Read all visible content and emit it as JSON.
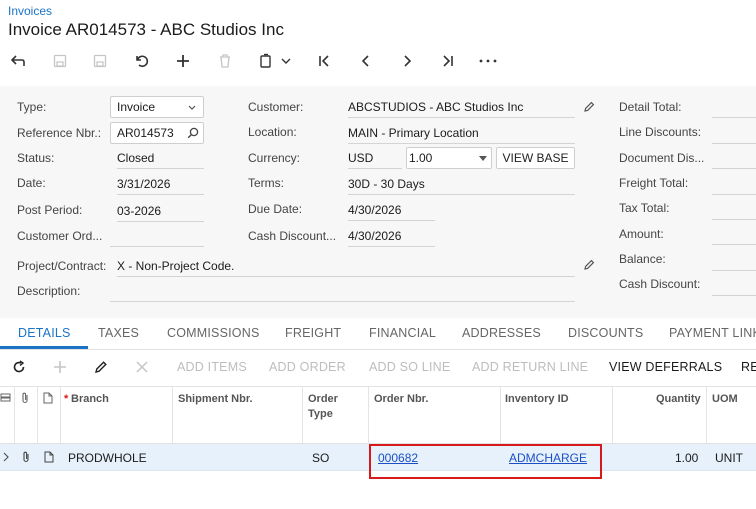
{
  "breadcrumb": "Invoices",
  "title": "Invoice AR014573 - ABC Studios Inc",
  "form": {
    "type_label": "Type:",
    "type_value": "Invoice",
    "refnbr_label": "Reference Nbr.:",
    "refnbr_value": "AR014573",
    "status_label": "Status:",
    "status_value": "Closed",
    "date_label": "Date:",
    "date_value": "3/31/2026",
    "postperiod_label": "Post Period:",
    "postperiod_value": "03-2026",
    "customerord_label": "Customer Ord...",
    "customerord_value": "",
    "customer_label": "Customer:",
    "customer_value": "ABCSTUDIOS - ABC Studios Inc",
    "location_label": "Location:",
    "location_value": "MAIN - Primary Location",
    "currency_label": "Currency:",
    "currency_value": "USD",
    "rate_value": "1.00",
    "view_base_label": "VIEW BASE",
    "terms_label": "Terms:",
    "terms_value": "30D - 30 Days",
    "duedate_label": "Due Date:",
    "duedate_value": "4/30/2026",
    "cashdiscount_label": "Cash Discount...",
    "cashdiscount_value": "4/30/2026",
    "project_label": "Project/Contract:",
    "project_value": "X - Non-Project Code.",
    "description_label": "Description:",
    "description_value": "",
    "detail_total_label": "Detail Total:",
    "line_discounts_label": "Line Discounts:",
    "document_dis_label": "Document Dis...",
    "freight_total_label": "Freight Total:",
    "tax_total_label": "Tax Total:",
    "amount_label": "Amount:",
    "balance_label": "Balance:",
    "cash_discount_label": "Cash Discount:"
  },
  "tabs": [
    "DETAILS",
    "TAXES",
    "COMMISSIONS",
    "FREIGHT",
    "FINANCIAL",
    "ADDRESSES",
    "DISCOUNTS",
    "PAYMENT LINK"
  ],
  "grid_toolbar": {
    "add_items": "ADD ITEMS",
    "add_order": "ADD ORDER",
    "add_so_line": "ADD SO LINE",
    "add_return_line": "ADD RETURN LINE",
    "view_deferrals": "VIEW DEFERRALS",
    "re": "RE"
  },
  "columns": {
    "required_mark": "*",
    "branch": "Branch",
    "shipment_nbr": "Shipment Nbr.",
    "order_type_1": "Order",
    "order_type_2": "Type",
    "order_nbr": "Order Nbr.",
    "inventory_id": "Inventory ID",
    "quantity": "Quantity",
    "uom": "UOM"
  },
  "row": {
    "branch": "PRODWHOLE",
    "shipment_nbr": "",
    "order_type": "SO",
    "order_nbr": "000682",
    "inventory_id": "ADMCHARGE",
    "quantity": "1.00",
    "uom": "UNIT"
  },
  "colors": {
    "accent": "#1a73c7",
    "highlight": "#d7191c"
  }
}
